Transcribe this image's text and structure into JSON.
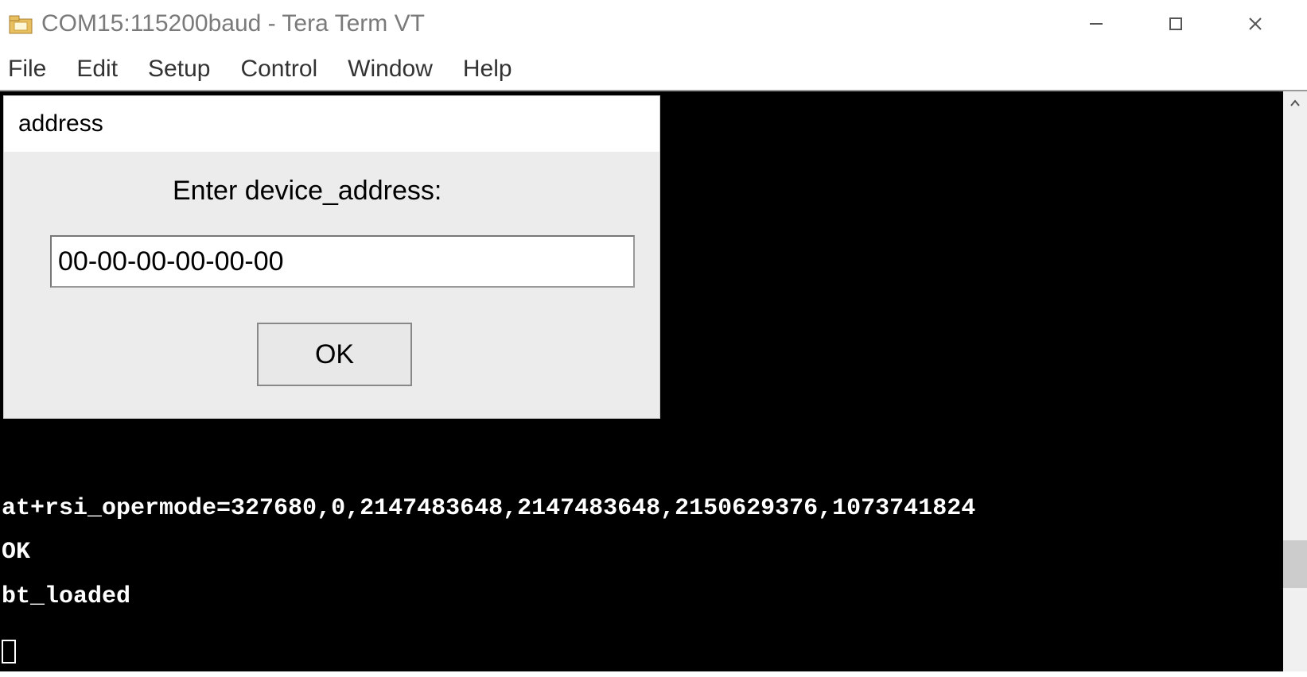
{
  "window": {
    "title": "COM15:115200baud - Tera Term VT"
  },
  "menu": {
    "file": "File",
    "edit": "Edit",
    "setup": "Setup",
    "control": "Control",
    "window": "Window",
    "help": "Help"
  },
  "terminal": {
    "line1": "at+rsi_opermode=327680,0,2147483648,2147483648,2150629376,1073741824",
    "line2": "OK",
    "line3": "bt_loaded"
  },
  "dialog": {
    "title": "address",
    "prompt": "Enter device_address:",
    "input_value": "00-00-00-00-00-00",
    "ok_label": "OK"
  }
}
